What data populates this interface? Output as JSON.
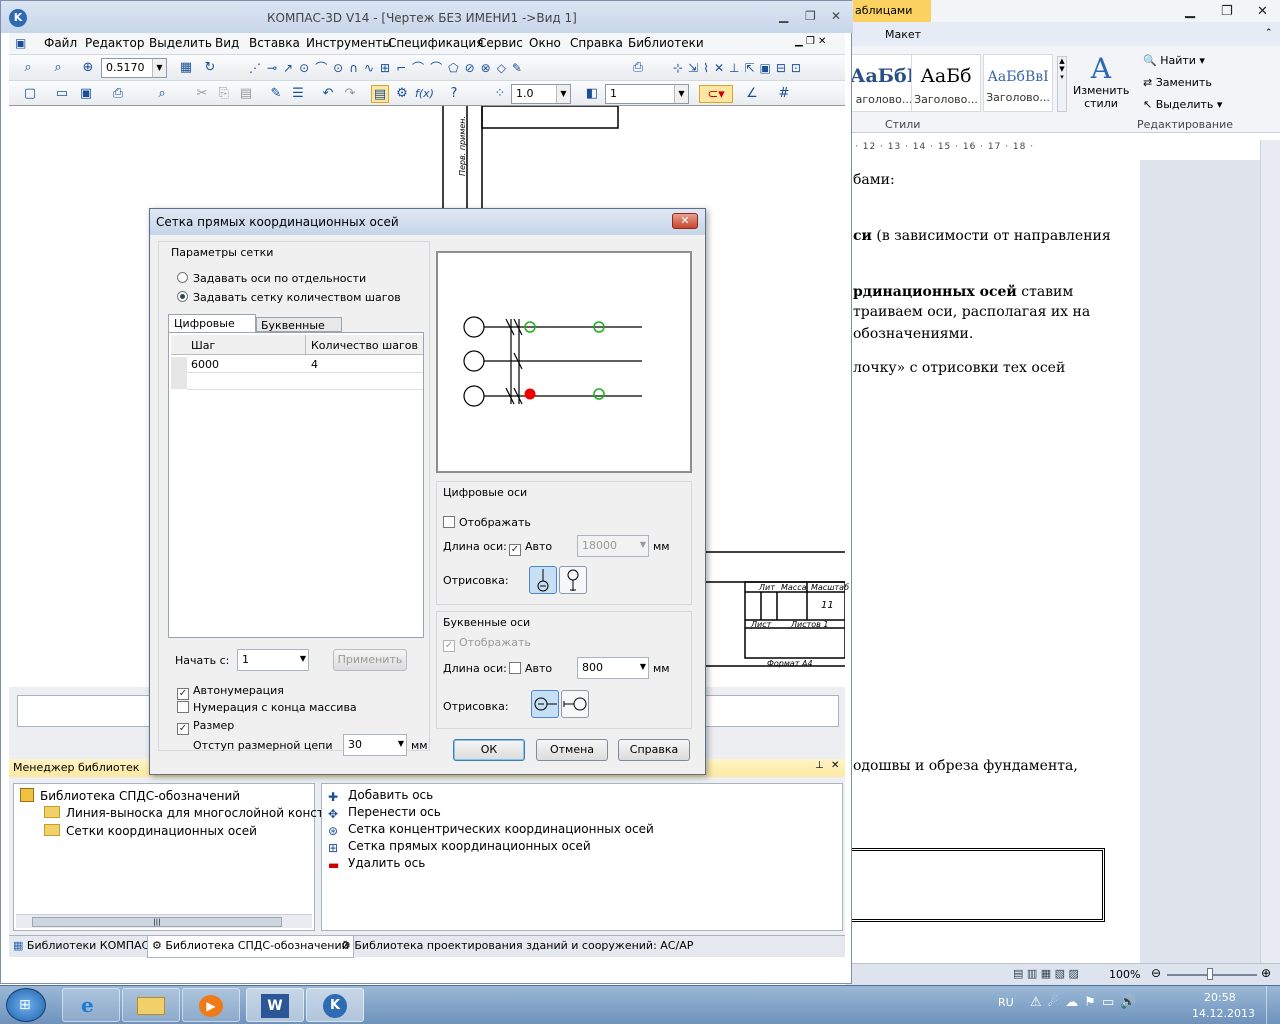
{
  "word": {
    "context_tab": "аблицами",
    "tab_layout": "Макет",
    "styles": [
      {
        "sample": "АаБбВ",
        "name": "аголово..."
      },
      {
        "sample": "АаБб",
        "name": "Заголово..."
      },
      {
        "sample": "АаБбВвI",
        "name": "Заголово..."
      }
    ],
    "change_styles": "Изменить стили",
    "find": "Найти",
    "replace": "Заменить",
    "select": "Выделить",
    "group_styles": "Стили",
    "group_editing": "Редактирование",
    "ruler": "· 12 · 13 · 14 · 15 · 16 · 17 · 18 ·",
    "body_lines": [
      {
        "text": "бами:",
        "bold": false
      },
      {
        "text_bold": "си",
        "text_rest": " (в зависимости от направления"
      },
      {
        "text_bold": "рдинационных осей",
        "text_rest": " ставим"
      },
      {
        "text": "траиваем оси, располагая их на",
        "bold": false
      },
      {
        "text": "обозначениями.",
        "bold": false
      },
      {
        "text": "лочку» с отрисовки тех осей",
        "bold": false
      },
      {
        "text": "одошвы и обреза фундамента,",
        "bold": false
      }
    ],
    "zoom": "100%"
  },
  "kompas": {
    "title": "КОМПАС-3D V14 - [Чертеж БЕЗ ИМЕНИ1 ->Вид 1]",
    "menu": [
      "Файл",
      "Редактор",
      "Выделить",
      "Вид",
      "Вставка",
      "Инструменты",
      "Спецификация",
      "Сервис",
      "Окно",
      "Справка",
      "Библиотеки"
    ],
    "zoom_value": "0.5170",
    "step_value": "1.0",
    "layer_value": "1",
    "title_block": {
      "sheet": "11",
      "format": "Формат  А4",
      "lit": "Лит",
      "mass": "Масса",
      "scale": "Масштаб",
      "list": "Лист",
      "lists": "Листов  1"
    },
    "lib_manager_title": "Менеджер библиотек",
    "lib_tree": [
      "Библиотека СПДС-обозначений",
      "Линия-выноска для многослойной конструк",
      "Сетки координационных осей"
    ],
    "lib_commands": [
      "Добавить ось",
      "Перенести ось",
      "Сетка концентрических координационных осей",
      "Сетка прямых координационных осей",
      "Удалить ось"
    ],
    "lib_tabs": [
      "Библиотеки КОМПАС",
      "Библиотека СПДС-обозначений",
      "Библиотека проектирования зданий и сооружений: АС/АР"
    ],
    "drawing_label": "Пред. примен."
  },
  "dialog": {
    "title": "Сетка прямых координационных осей",
    "grid_params": "Параметры сетки",
    "radio_separate": "Задавать оси по отдельности",
    "radio_steps": "Задавать сетку количеством шагов",
    "tab_digital": "Цифровые оси",
    "tab_letter": "Буквенные оси",
    "col_step": "Шаг",
    "col_count": "Количество шагов",
    "rows": [
      {
        "step": "6000",
        "count": "4"
      }
    ],
    "start_from_label": "Начать с:",
    "start_from_value": "1",
    "apply": "Применить",
    "autonum": "Автонумерация",
    "num_from_end": "Нумерация с конца массива",
    "size": "Размер",
    "dim_offset_label": "Отступ размерной цепи",
    "dim_offset_value": "30",
    "unit_mm": "мм",
    "digital_axes": "Цифровые оси",
    "display": "Отображать",
    "axis_length": "Длина оси:",
    "auto": "Авто",
    "digital_length": "18000",
    "drawing": "Отрисовка:",
    "letter_axes": "Буквенные оси",
    "letter_length": "800",
    "ok": "ОК",
    "cancel": "Отмена",
    "help": "Справка"
  },
  "taskbar": {
    "lang": "RU",
    "time": "20:58",
    "date": "14.12.2013"
  }
}
